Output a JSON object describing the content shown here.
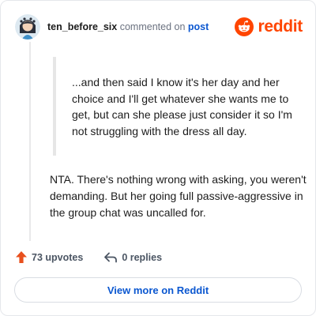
{
  "header": {
    "username": "ten_before_six",
    "action_text": "commented on",
    "post_link": "post",
    "brand_name": "reddit"
  },
  "quote": {
    "text": "...and then said I know it's her day and her choice and I'll get whatever she wants me to get, but can she please just consider it so I'm not struggling with the dress all day."
  },
  "comment": {
    "text": "NTA. There's nothing wrong with asking, you weren't demanding. But her going full passive-aggressive in the group chat was uncalled for."
  },
  "actions": {
    "upvotes_label": "73 upvotes",
    "replies_label": "0 replies"
  },
  "footer": {
    "view_button_label": "View more on Reddit"
  },
  "icons": {
    "avatar": "avatar-illustration",
    "brand": "reddit-logo-icon",
    "upvote": "upvote-arrow-icon",
    "reply": "reply-arrow-icon"
  },
  "colors": {
    "brand": "#ff4500",
    "link": "#0b57d0",
    "upvote": "#e8501e",
    "text": "#1c1c1c",
    "muted": "#6b7280"
  }
}
